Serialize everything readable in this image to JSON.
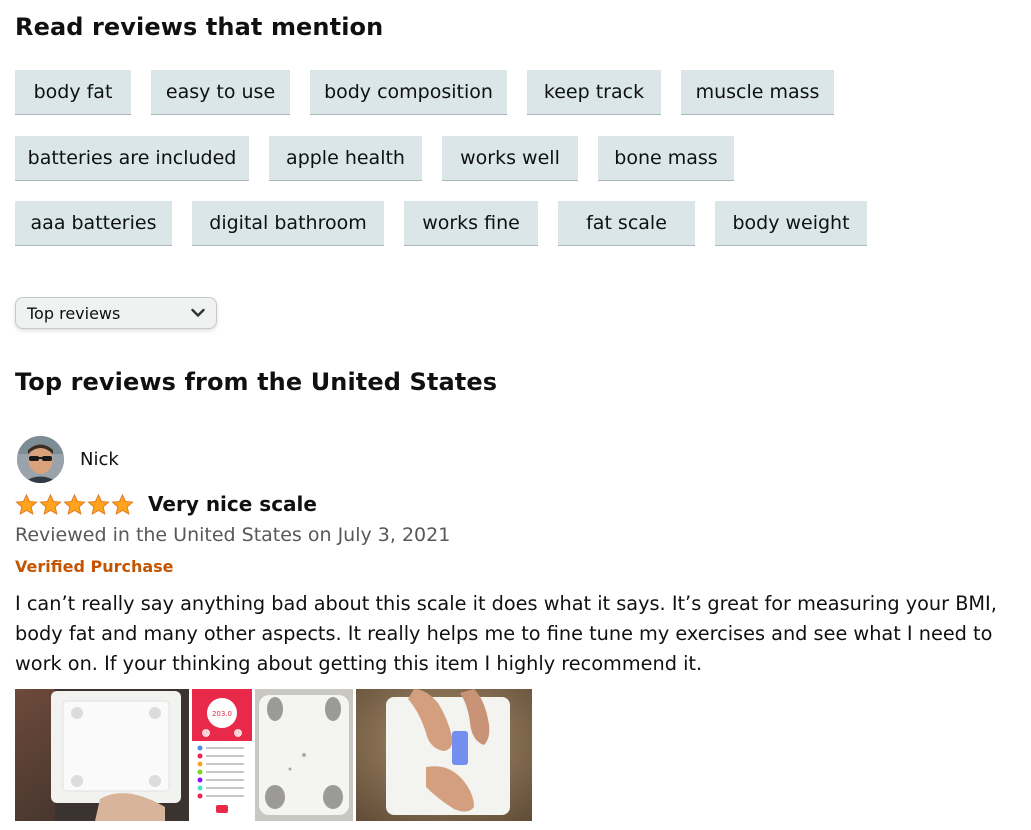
{
  "mentions": {
    "title": "Read reviews that mention",
    "row1": [
      "body fat",
      "easy to use",
      "body composition",
      "keep track",
      "muscle mass"
    ],
    "row2": [
      "batteries are included",
      "apple health",
      "works well",
      "bone mass"
    ],
    "row3": [
      "aaa batteries",
      "digital bathroom",
      "works fine",
      "fat scale",
      "body weight"
    ]
  },
  "sort": {
    "selected": "Top reviews",
    "icon": "chevron-down-icon"
  },
  "reviews_section": {
    "title": "Top reviews from the United States"
  },
  "review": {
    "reviewer_name": "Nick",
    "rating": 5,
    "rating_max": 5,
    "star_color": "#FFA41C",
    "title": "Very nice scale",
    "date_line": "Reviewed in the United States on July 3, 2021",
    "verified": "Verified Purchase",
    "verified_color": "#C45500",
    "body": "I can’t really say anything bad about this scale it does what it says. It’s great for measuring your BMI, body fat and many other aspects. It really helps me to fine tune my exercises and see what I need to work on. If your thinking about getting this item I highly recommend it.",
    "photos": [
      "scale-photo-1",
      "app-screenshot",
      "scale-photo-2",
      "feet-on-scale-photo"
    ],
    "app_reading": "203.0"
  }
}
